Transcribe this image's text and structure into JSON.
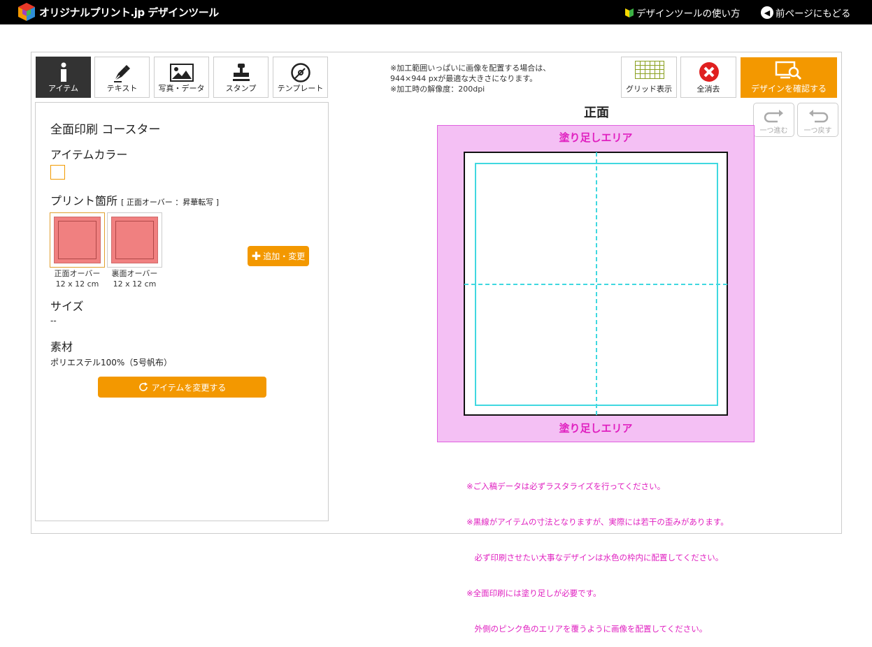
{
  "app": {
    "title": "オリジナルプリント.jp デザインツール",
    "howto_label": "デザインツールの使い方",
    "back_label": "前ページにもどる"
  },
  "tabs": [
    {
      "label": "アイテム",
      "icon": "info-icon",
      "active": true
    },
    {
      "label": "テキスト",
      "icon": "pen-icon",
      "active": false
    },
    {
      "label": "写真・データ",
      "icon": "image-icon",
      "active": false
    },
    {
      "label": "スタンプ",
      "icon": "stamp-icon",
      "active": false
    },
    {
      "label": "テンプレート",
      "icon": "disc-icon",
      "active": false
    }
  ],
  "panel": {
    "item_name": "全面印刷 コースター",
    "color_heading": "アイテムカラー",
    "print_heading": "プリント箇所",
    "print_sub": "[ 正面オーバー ：昇華転写 ]",
    "positions": [
      {
        "name": "正面オーバー",
        "size": "12 x 12 cm",
        "selected": true
      },
      {
        "name": "裏面オーバー",
        "size": "12 x 12 cm",
        "selected": false
      }
    ],
    "add_change_label": "追加・変更",
    "size_heading": "サイズ",
    "size_value": "--",
    "material_heading": "素材",
    "material_value": "ポリエステル100%（5号帆布）",
    "change_item_label": "アイテムを変更する"
  },
  "notes_top": [
    "※加工範囲いっぱいに画像を配置する場合は、",
    "944×944 pxが最適な大きさになります。",
    "※加工時の解像度：200dpi"
  ],
  "toolbar": {
    "grid_label": "グリッド表示",
    "clear_label": "全消去",
    "confirm_label": "デザインを確認する",
    "redo_label": "一つ進む",
    "undo_label": "一つ戻す"
  },
  "canvas": {
    "face_title": "正面",
    "bleed_top": "塗り足しエリア",
    "bleed_bottom": "塗り足しエリア"
  },
  "notes_bottom": [
    "※ご入稿データは必ずラスタライズを行ってください。",
    "※黒線がアイテムの寸法となりますが、実際には若干の歪みがあります。",
    "　必ず印刷させたい大事なデザインは水色の枠内に配置してください。",
    "※全面印刷には塗り足しが必要です。",
    "　外側のピンク色のエリアを覆うように画像を配置してください。"
  ],
  "colors": {
    "accent": "#f39800",
    "bleed": "#f4c0f4",
    "safe_line": "#40d8e0",
    "note_text": "#e020c0"
  }
}
